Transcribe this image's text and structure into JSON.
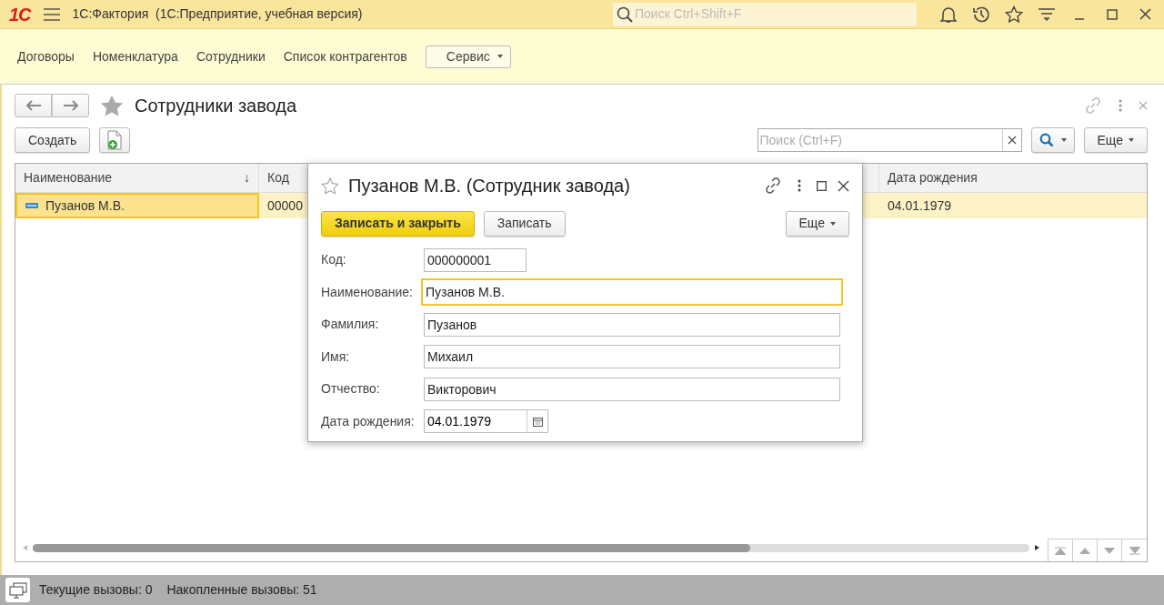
{
  "window": {
    "logo": "1С",
    "title": "1С:Фактория  (1С:Предприятие, учебная версия)",
    "search": {
      "placeholder": "Поиск Ctrl+Shift+F"
    }
  },
  "sections": [
    "Договоры",
    "Номенклатура",
    "Сотрудники",
    "Список контрагентов"
  ],
  "service_menu": "Сервис",
  "form": {
    "title": "Сотрудники завода",
    "create": "Создать",
    "search": {
      "placeholder": "Поиск (Ctrl+F)"
    },
    "more": "Еще"
  },
  "table": {
    "columns": [
      {
        "label": "Наименование",
        "sort_mark": "↓"
      },
      {
        "label": "Код"
      },
      {
        "label": "Дата рождения"
      }
    ],
    "rows": [
      {
        "cells": [
          "Пузанов М.В.",
          "00000",
          "04.01.1979"
        ],
        "selected": true
      }
    ]
  },
  "dialog": {
    "title": "Пузанов М.В. (Сотрудник завода)",
    "more": "Еще",
    "buttons": [
      {
        "label": "Записать и закрыть",
        "kind": "primary"
      },
      {
        "label": "Записать",
        "kind": "default"
      }
    ],
    "fields": [
      {
        "label": "Код:",
        "value": "000000001",
        "kind": "short",
        "focused": false
      },
      {
        "label": "Наименование:",
        "value": "Пузанов М.В.",
        "kind": "text",
        "focused": true
      },
      {
        "label": "Фамилия:",
        "value": "Пузанов",
        "kind": "text",
        "focused": false
      },
      {
        "label": "Имя:",
        "value": "Михаил",
        "kind": "text",
        "focused": false
      },
      {
        "label": "Отчество:",
        "value": "Викторович",
        "kind": "text",
        "focused": false
      },
      {
        "label": "Дата рождения:",
        "value": "04.01.1979",
        "kind": "date",
        "focused": false
      }
    ]
  },
  "status_bar": [
    "Текущие вызовы: 0",
    "Накопленные вызовы: 51"
  ]
}
